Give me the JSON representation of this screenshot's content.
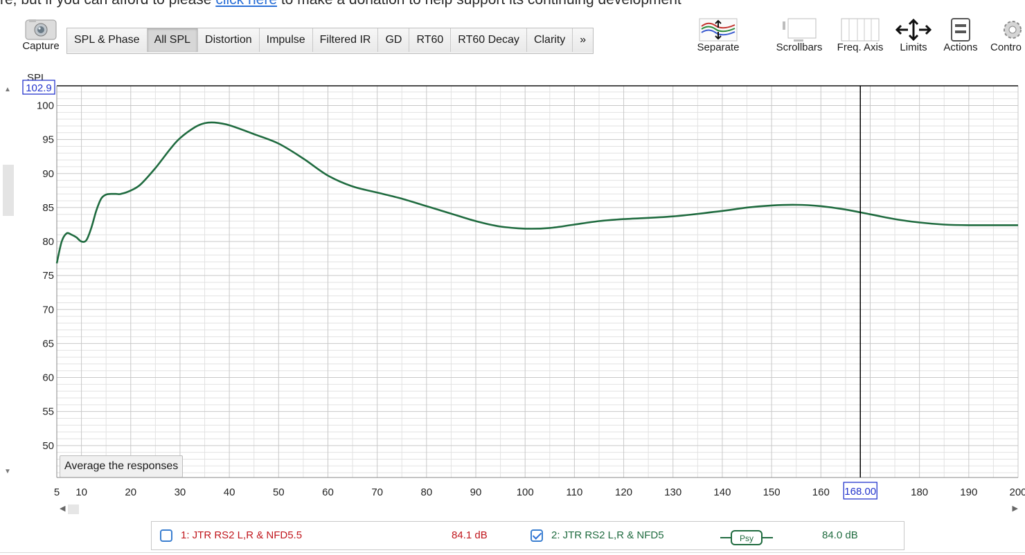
{
  "banner": {
    "text_before": "re, but if you can afford to please ",
    "link": "click here",
    "text_after": " to make a donation to help support its continuing development"
  },
  "toolbar": {
    "capture_label": "Capture",
    "tabs": [
      {
        "label": "SPL & Phase",
        "active": false
      },
      {
        "label": "All SPL",
        "active": true
      },
      {
        "label": "Distortion",
        "active": false
      },
      {
        "label": "Impulse",
        "active": false
      },
      {
        "label": "Filtered IR",
        "active": false
      },
      {
        "label": "GD",
        "active": false
      },
      {
        "label": "RT60",
        "active": false
      },
      {
        "label": "RT60 Decay",
        "active": false
      },
      {
        "label": "Clarity",
        "active": false
      },
      {
        "label": "»",
        "active": false
      }
    ],
    "separate_label": "Separate",
    "scrollbars_label": "Scrollbars",
    "freq_axis_label": "Freq. Axis",
    "limits_label": "Limits",
    "actions_label": "Actions",
    "controls_label": "Contro"
  },
  "colors": {
    "trace": "#1f6b3f",
    "grid_major": "#c8c8c8",
    "grid_minor": "#e2e2e2",
    "readout_border": "#2233cc",
    "legend_red": "#c0161c",
    "legend_green": "#1f6b3f"
  },
  "chart_data": {
    "type": "line",
    "ylabel": "SPL",
    "y_readout": "102.9",
    "y_ticks": [
      100,
      95,
      90,
      85,
      80,
      75,
      70,
      65,
      60,
      55,
      50
    ],
    "ylim": [
      45.3,
      102.9
    ],
    "xlim": [
      5,
      200
    ],
    "x_ticks": [
      5,
      10,
      20,
      30,
      40,
      50,
      60,
      70,
      80,
      90,
      100,
      110,
      120,
      130,
      140,
      150,
      160,
      170,
      180,
      190,
      200
    ],
    "x_tick_labels": [
      "5",
      "10",
      "20",
      "30",
      "40",
      "50",
      "60",
      "70",
      "80",
      "90",
      "100",
      "110",
      "120",
      "130",
      "140",
      "150",
      "160",
      "",
      "180",
      "190",
      "200"
    ],
    "cursor_x": 168.0,
    "cursor_label": "168.00",
    "grid": true,
    "series": [
      {
        "name": "2: JTR RS2 L,R & NFD5",
        "x": [
          5,
          6,
          7,
          8,
          9,
          10,
          11,
          12,
          13,
          14,
          15,
          16,
          17,
          18,
          20,
          22,
          25,
          28,
          30,
          33,
          35,
          37,
          40,
          45,
          50,
          55,
          60,
          65,
          70,
          75,
          80,
          85,
          90,
          95,
          100,
          105,
          110,
          115,
          120,
          130,
          140,
          145,
          150,
          155,
          160,
          165,
          170,
          175,
          180,
          185,
          190,
          195,
          200
        ],
        "y": [
          76.8,
          80.0,
          81.2,
          81.0,
          80.6,
          80.0,
          80.2,
          82.0,
          84.5,
          86.3,
          86.9,
          87.0,
          87.0,
          87.0,
          87.5,
          88.4,
          90.8,
          93.6,
          95.2,
          96.8,
          97.4,
          97.5,
          97.1,
          95.8,
          94.4,
          92.2,
          89.7,
          88.1,
          87.2,
          86.3,
          85.2,
          84.1,
          83.0,
          82.2,
          81.9,
          82.0,
          82.5,
          83.0,
          83.3,
          83.7,
          84.5,
          85.0,
          85.3,
          85.4,
          85.2,
          84.7,
          84.0,
          83.3,
          82.8,
          82.5,
          82.4,
          82.4,
          82.4
        ]
      }
    ]
  },
  "average_button_label": "Average the responses",
  "legend": {
    "items": [
      {
        "label": "1: JTR RS2 L,R & NFD5.5",
        "value": "84.1 dB",
        "checked": false
      },
      {
        "label": "2: JTR RS2 L,R & NFD5",
        "value": "84.0 dB",
        "checked": true
      }
    ],
    "smoothing_badge": "Psy"
  }
}
